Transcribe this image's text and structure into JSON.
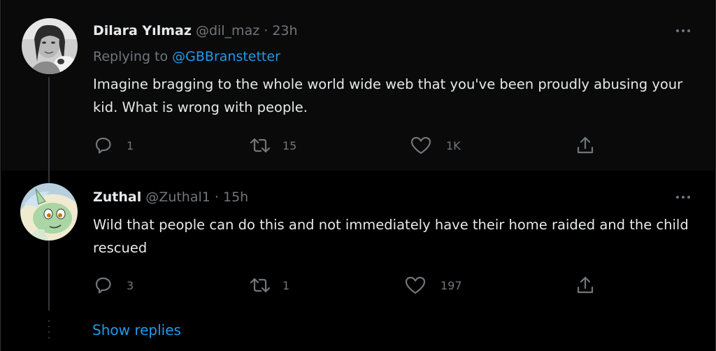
{
  "colors": {
    "background": "#000000",
    "text": "#e7e9ea",
    "muted": "#71767b",
    "link": "#1d9bf0",
    "divider": "#2f3336"
  },
  "tweets": [
    {
      "name": "Dilara Yılmaz",
      "handle": "@dil_maz",
      "separator": "·",
      "time": "23h",
      "replying_prefix": "Replying to ",
      "replying_to": "@GBBranstetter",
      "body": "Imagine bragging to the whole world wide web that you've been proudly abusing your kid. What is wrong with people.",
      "replies": "1",
      "retweets": "15",
      "likes": "1K",
      "avatar_icon": "profile-photo"
    },
    {
      "name": "Zuthal",
      "handle": "@Zuthal1",
      "separator": "·",
      "time": "15h",
      "body": "Wild that people can do this and not immediately have their home raided and the child rescued",
      "replies": "3",
      "retweets": "1",
      "likes": "197",
      "avatar_icon": "cartoon-pony-avatar"
    }
  ],
  "show_replies": "Show replies",
  "icons": [
    "reply-icon",
    "retweet-icon",
    "like-icon",
    "share-icon",
    "more-icon"
  ]
}
